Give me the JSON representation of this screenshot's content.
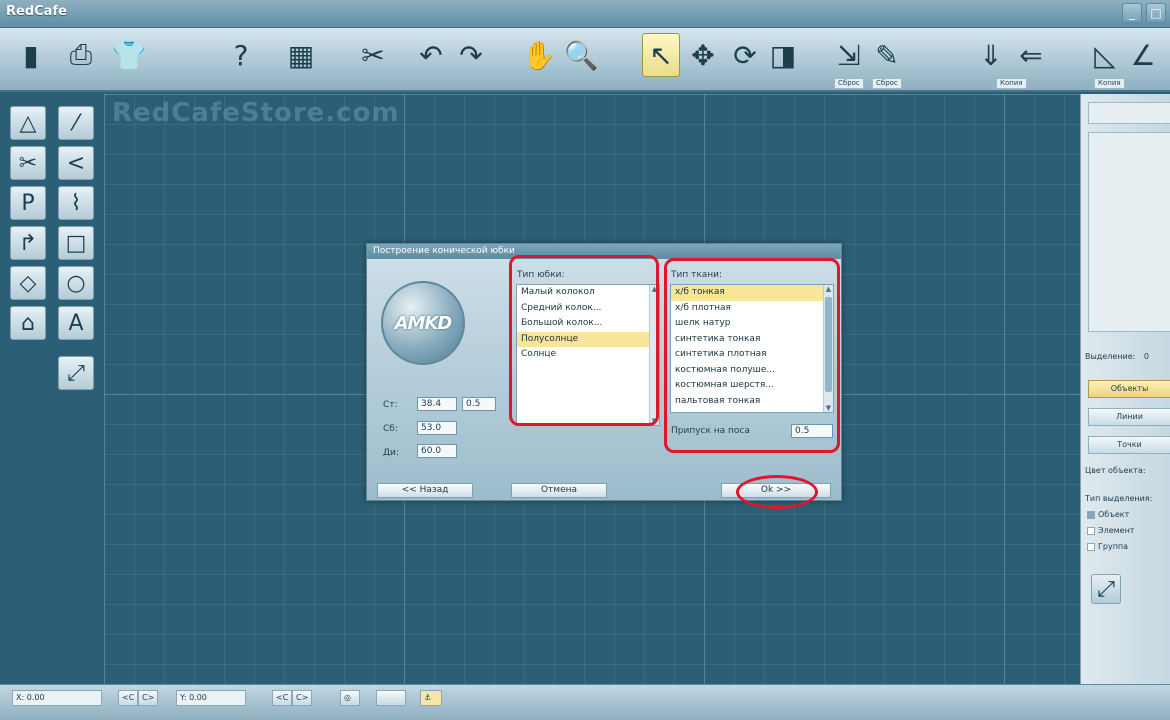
{
  "app": {
    "title": "RedCafe",
    "watermark": "RedCafeStore.com"
  },
  "toolbar": {
    "labels": {
      "reset1": "Сброс",
      "reset2": "Сброс",
      "copy1": "Копия",
      "copy2": "Копия"
    }
  },
  "dialog": {
    "title": "Построение конической юбки",
    "logo_text": "AMKD",
    "skirt_type_label": "Тип юбки:",
    "skirt_types": [
      "Малый колокол",
      "Средний колок...",
      "Большой колок...",
      "Полусолнце",
      "Солнце"
    ],
    "skirt_selected_index": 3,
    "fabric_type_label": "Тип ткани:",
    "fabric_types": [
      "х/б тонкая",
      "х/б плотная",
      "шелк натур",
      "синтетика тонкая",
      "синтетика плотная",
      "костюмная полуше...",
      "костюмная шерстя...",
      "пальтовая тонкая"
    ],
    "fabric_selected_index": 0,
    "allowance_label": "Припуск на поса",
    "allowance_value": "0.5",
    "st_label": "Ст:",
    "st_value": "38.4",
    "st_extra": "0.5",
    "sb_label": "Сб:",
    "sb_value": "53.0",
    "di_label": "Ди:",
    "di_value": "60.0",
    "back_button": "<< Назад",
    "cancel_button": "Отмена",
    "ok_button": "Ok >>"
  },
  "right_panel": {
    "selection_label": "Выделение:",
    "selection_count": "0",
    "objects_button": "Объекты",
    "lines_button": "Линии",
    "points_button": "Точки",
    "object_color_label": "Цвет объекта:",
    "selection_type_label": "Тип выделения:",
    "options": [
      "Объект",
      "Элемент",
      "Группа"
    ]
  },
  "statusbar": {
    "x_label": "X:",
    "x_value": "0.00",
    "y_label": "Y:",
    "y_value": "0.00",
    "prev": "<C",
    "next": "C>"
  },
  "colors": {
    "accent": "#e2152b",
    "selection": "#f6e59a",
    "canvas": "#2c5f75"
  }
}
